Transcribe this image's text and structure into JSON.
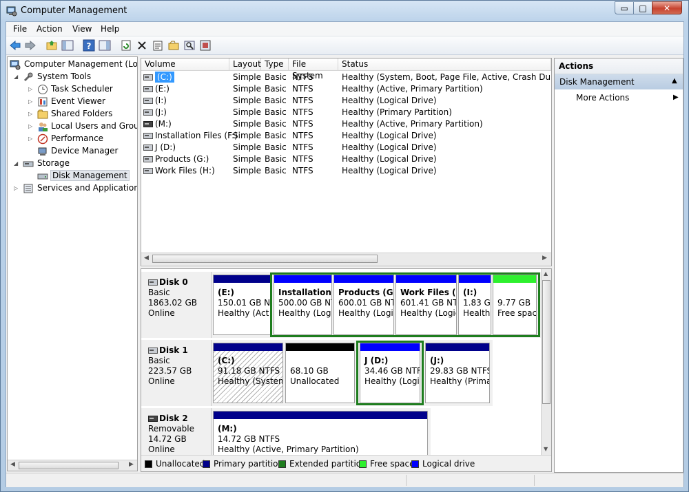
{
  "window": {
    "title": "Computer Management",
    "controls": {
      "minimize": "▭",
      "maximize": "□",
      "close": "✕"
    }
  },
  "menu": [
    "File",
    "Action",
    "View",
    "Help"
  ],
  "toolbar": [
    "back-icon",
    "forward-icon",
    "up-folder-icon",
    "show-hide-tree-icon",
    "help-icon",
    "show-hide-action-pane-icon",
    "refresh-icon",
    "delete-icon",
    "properties-icon",
    "open-icon",
    "search-icon",
    "settings-icon"
  ],
  "tree": {
    "root": "Computer Management (Local",
    "system_tools": "System Tools",
    "task_scheduler": "Task Scheduler",
    "event_viewer": "Event Viewer",
    "shared_folders": "Shared Folders",
    "local_users": "Local Users and Groups",
    "performance": "Performance",
    "device_manager": "Device Manager",
    "storage": "Storage",
    "disk_management": "Disk Management",
    "services": "Services and Applications"
  },
  "volumes": {
    "headers": [
      "Volume",
      "Layout",
      "Type",
      "File System",
      "Status"
    ],
    "rows": [
      {
        "volume": "(C:)",
        "layout": "Simple",
        "type": "Basic",
        "fs": "NTFS",
        "status": "Healthy (System, Boot, Page File, Active, Crash Dump, Pri"
      },
      {
        "volume": "(E:)",
        "layout": "Simple",
        "type": "Basic",
        "fs": "NTFS",
        "status": "Healthy (Active, Primary Partition)"
      },
      {
        "volume": "(I:)",
        "layout": "Simple",
        "type": "Basic",
        "fs": "NTFS",
        "status": "Healthy (Logical Drive)"
      },
      {
        "volume": "(J:)",
        "layout": "Simple",
        "type": "Basic",
        "fs": "NTFS",
        "status": "Healthy (Primary Partition)"
      },
      {
        "volume": "(M:)",
        "layout": "Simple",
        "type": "Basic",
        "fs": "NTFS",
        "status": "Healthy (Active, Primary Partition)"
      },
      {
        "volume": "Installation Files (F:)",
        "layout": "Simple",
        "type": "Basic",
        "fs": "NTFS",
        "status": "Healthy (Logical Drive)"
      },
      {
        "volume": "J (D:)",
        "layout": "Simple",
        "type": "Basic",
        "fs": "NTFS",
        "status": "Healthy (Logical Drive)"
      },
      {
        "volume": "Products (G:)",
        "layout": "Simple",
        "type": "Basic",
        "fs": "NTFS",
        "status": "Healthy (Logical Drive)"
      },
      {
        "volume": "Work Files (H:)",
        "layout": "Simple",
        "type": "Basic",
        "fs": "NTFS",
        "status": "Healthy (Logical Drive)"
      }
    ]
  },
  "disks": [
    {
      "name": "Disk 0",
      "type": "Basic",
      "size": "1863.02 GB",
      "state": "Online"
    },
    {
      "name": "Disk 1",
      "type": "Basic",
      "size": "223.57 GB",
      "state": "Online"
    },
    {
      "name": "Disk 2",
      "type": "Removable",
      "size": "14.72 GB",
      "state": "Online"
    }
  ],
  "partitions": {
    "d0_e": {
      "name": "(E:)",
      "size": "150.01 GB NT",
      "status": "Healthy (Act"
    },
    "d0_f": {
      "name": "Installation F",
      "size": "500.00 GB NT",
      "status": "Healthy (Logi"
    },
    "d0_g": {
      "name": "Products  (G:)",
      "size": "600.01 GB NTF",
      "status": "Healthy (Logic"
    },
    "d0_h": {
      "name": "Work Files  (H",
      "size": "601.41 GB NTF",
      "status": "Healthy (Logic"
    },
    "d0_i": {
      "name": "(I:)",
      "size": "1.83 GI",
      "status": "Health"
    },
    "d0_free": {
      "name": "",
      "size": "9.77 GB",
      "status": "Free spac"
    },
    "d1_c": {
      "name": "(C:)",
      "size": "91.18 GB NTFS",
      "status": "Healthy (System,"
    },
    "d1_un": {
      "name": "",
      "size": "68.10 GB",
      "status": "Unallocated"
    },
    "d1_d": {
      "name": "J  (D:)",
      "size": "34.46 GB NTFS",
      "status": "Healthy (Logi"
    },
    "d1_j": {
      "name": "(J:)",
      "size": "29.83 GB NTFS",
      "status": "Healthy (Primar"
    },
    "d2_m": {
      "name": "(M:)",
      "size": "14.72 GB NTFS",
      "status": "Healthy (Active, Primary Partition)"
    }
  },
  "legend": [
    "Unallocated",
    "Primary partition",
    "Extended partition",
    "Free space",
    "Logical drive"
  ],
  "colors": {
    "unallocated": "#000000",
    "primary": "#00008b",
    "extended": "#1e7d1e",
    "free": "#2ef02e",
    "logical": "#0000ff",
    "selected_row": "#3399ff"
  },
  "actions": {
    "title": "Actions",
    "section": "Disk Management",
    "more": "More Actions"
  }
}
